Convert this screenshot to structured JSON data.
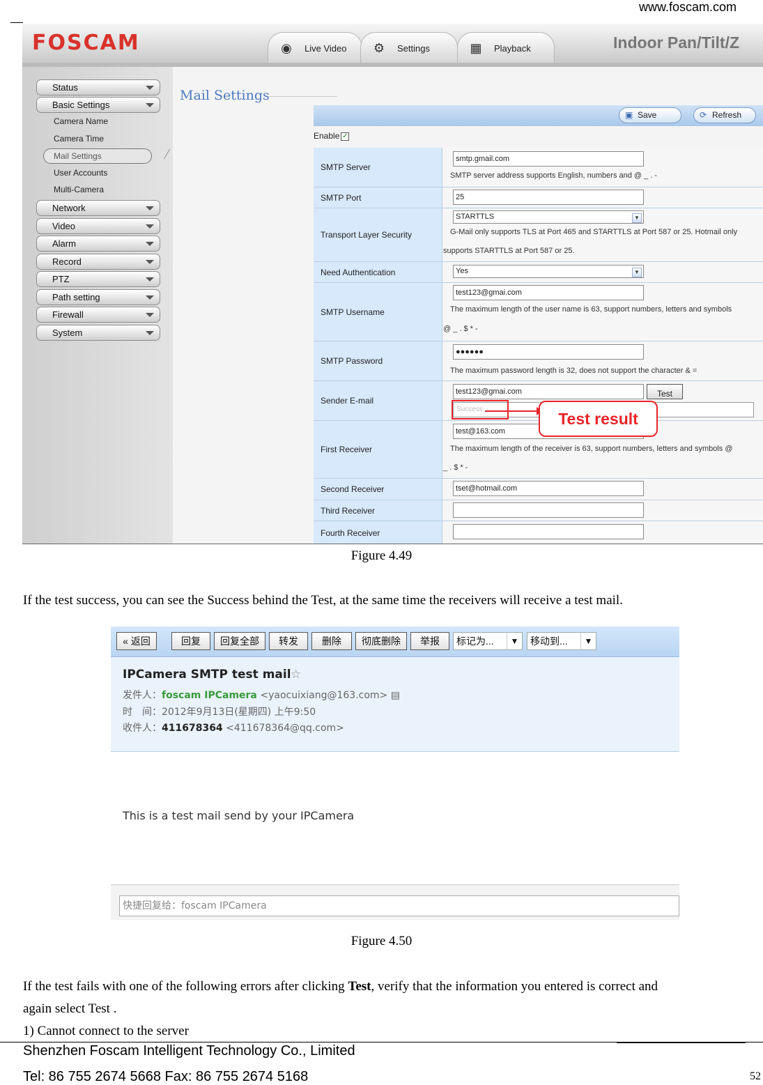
{
  "header": {
    "site_url": "www.foscam.com"
  },
  "figure1": {
    "logo": "FOSCAM",
    "tabs": [
      {
        "label": "Live Video",
        "icon": "webcam-icon"
      },
      {
        "label": "Settings",
        "icon": "gear-icon"
      },
      {
        "label": "Playback",
        "icon": "calendar-icon"
      }
    ],
    "model": "Indoor Pan/Tilt/Z",
    "sidebar": {
      "menus": [
        "Status",
        "Basic Settings",
        "Network",
        "Video",
        "Alarm",
        "Record",
        "PTZ",
        "Path setting",
        "Firewall",
        "System"
      ],
      "submenu": [
        "Camera Name",
        "Camera Time",
        "Mail Settings",
        "User Accounts",
        "Multi-Camera"
      ]
    },
    "page_title": "Mail Settings",
    "toolbar": {
      "save": "Save",
      "refresh": "Refresh"
    },
    "enable_label": "Enable",
    "enable_checked": true,
    "rows": {
      "smtp_server": {
        "label": "SMTP Server",
        "value": "smtp.gmail.com",
        "hint": "SMTP server address supports English, numbers and @ _ . -"
      },
      "smtp_port": {
        "label": "SMTP Port",
        "value": "25"
      },
      "tls": {
        "label": "Transport Layer Security",
        "value": "STARTTLS",
        "hint1": "G-Mail only supports TLS at Port 465 and STARTTLS at Port 587 or 25. Hotmail only",
        "hint2": "supports STARTTLS at Port 587 or 25."
      },
      "auth": {
        "label": "Need Authentication",
        "value": "Yes"
      },
      "username": {
        "label": "SMTP Username",
        "value": "test123@gmai.com",
        "hint1": "The maximum length of the user name is 63, support numbers, letters and symbols",
        "hint2": "@ _ . $ * -"
      },
      "password": {
        "label": "SMTP Password",
        "value": "●●●●●●",
        "hint": "The maximum password length is 32, does not support the character & ="
      },
      "sender": {
        "label": "Sender E-mail",
        "value": "test123@gmai.com",
        "test_button": "Test",
        "result": "Success"
      },
      "first": {
        "label": "First Receiver",
        "value": "test@163.com",
        "hint1": "The maximum length of the receiver is 63, support numbers, letters and symbols @",
        "hint2": "_ . $ * -"
      },
      "second": {
        "label": "Second Receiver",
        "value": "tset@hotmail.com"
      },
      "third": {
        "label": "Third Receiver",
        "value": ""
      },
      "fourth": {
        "label": "Fourth Receiver",
        "value": ""
      }
    },
    "callout": "Test result",
    "accent": "#e8242b"
  },
  "caption1": "Figure 4.49",
  "para1": "If the test success, you can see the Success behind the Test, at the same time the receivers will receive a test mail.",
  "figure2": {
    "toolbar": {
      "back": "« 返回",
      "reply": "回复",
      "reply_all": "回复全部",
      "forward": "转发",
      "delete": "删除",
      "delete_perm": "彻底删除",
      "report": "举报",
      "mark_as": "标记为...",
      "move_to": "移动到..."
    },
    "subject": "IPCamera SMTP test mail",
    "from_label": "发件人：",
    "from_name": "foscam IPCamera",
    "from_addr": "<yaocuixiang@163.com>",
    "time_label": "时　间：",
    "time_value": "2012年9月13日(星期四) 上午9:50",
    "to_label": "收件人：",
    "to_name": "411678364",
    "to_addr": "<411678364@qq.com>",
    "body": "This is a test mail send by your IPCamera",
    "quick_reply": "快捷回复给：foscam IPCamera"
  },
  "caption2": "Figure 4.50",
  "para2_a": "If the test fails with one of the following errors after clicking ",
  "para2_bold": "Test",
  "para2_b": ", verify that the information you entered is correct and",
  "para3": "again select Test .",
  "para4": "1) Cannot connect to the server",
  "footer": {
    "company": "Shenzhen Foscam Intelligent Technology Co., Limited",
    "tel": "Tel: 86 755 2674 5668 Fax: 86 755 2674 5168",
    "page": "52"
  }
}
